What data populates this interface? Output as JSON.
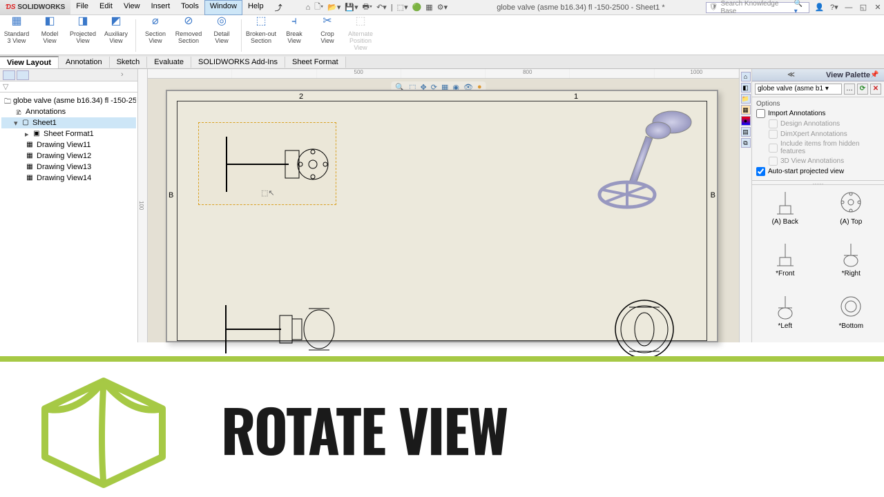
{
  "app": {
    "name": "SOLIDWORKS",
    "doc_title": "globe valve (asme b16.34) fl -150-2500 - Sheet1 *"
  },
  "menu": {
    "items": [
      "File",
      "Edit",
      "View",
      "Insert",
      "Tools",
      "Window",
      "Help"
    ],
    "active": "Window"
  },
  "search": {
    "placeholder": "Search Knowledge Base"
  },
  "ribbon": {
    "buttons": [
      {
        "l1": "Standard",
        "l2": "3 View"
      },
      {
        "l1": "Model",
        "l2": "View"
      },
      {
        "l1": "Projected",
        "l2": "View"
      },
      {
        "l1": "Auxiliary",
        "l2": "View"
      },
      {
        "l1": "Section",
        "l2": "View"
      },
      {
        "l1": "Removed",
        "l2": "Section"
      },
      {
        "l1": "Detail",
        "l2": "View"
      },
      {
        "l1": "Broken-out",
        "l2": "Section"
      },
      {
        "l1": "Break",
        "l2": "View"
      },
      {
        "l1": "Crop",
        "l2": "View"
      },
      {
        "l1": "Alternate",
        "l2": "Position View",
        "disabled": true
      }
    ]
  },
  "tabs": {
    "items": [
      "View Layout",
      "Annotation",
      "Sketch",
      "Evaluate",
      "SOLIDWORKS Add-Ins",
      "Sheet Format"
    ],
    "active": "View Layout"
  },
  "tree": {
    "root": "globe valve (asme b16.34) fl -150-25",
    "annotations": "Annotations",
    "sheet": "Sheet1",
    "format": "Sheet Format1",
    "views": [
      "Drawing View11",
      "Drawing View12",
      "Drawing View13",
      "Drawing View14"
    ]
  },
  "ruler": {
    "h": [
      "",
      "",
      "500",
      "",
      "800",
      "",
      "1000"
    ],
    "v": "100"
  },
  "sheet": {
    "cols": [
      "2",
      "1"
    ],
    "rowsL": "B",
    "rowsR": "B"
  },
  "palette": {
    "title": "View Palette",
    "selected": "globe valve (asme b1",
    "options_label": "Options",
    "import_ann": "Import Annotations",
    "da": "Design Annotations",
    "dx": "DimXpert Annotations",
    "hid": "Include items from hidden features",
    "tv": "3D View Annotations",
    "autostart": "Auto-start projected view",
    "thumbs": [
      {
        "lbl": "(A) Back"
      },
      {
        "lbl": "(A) Top"
      },
      {
        "lbl": "*Front"
      },
      {
        "lbl": "*Right"
      },
      {
        "lbl": "*Left"
      },
      {
        "lbl": "*Bottom"
      }
    ]
  },
  "overlay": {
    "title": "ROTATE VIEW"
  }
}
